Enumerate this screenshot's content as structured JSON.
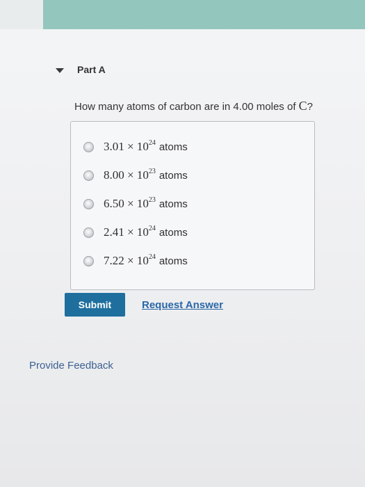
{
  "part": {
    "title": "Part A"
  },
  "question": {
    "text": "How many atoms of carbon are in 4.00 moles of ",
    "symbol": "C",
    "tail": "?"
  },
  "options": [
    {
      "mantissa": "3.01 × 10",
      "exponent": "24",
      "unit": "atoms"
    },
    {
      "mantissa": "8.00 × 10",
      "exponent": "23",
      "unit": "atoms"
    },
    {
      "mantissa": "6.50 × 10",
      "exponent": "23",
      "unit": "atoms"
    },
    {
      "mantissa": "2.41 × 10",
      "exponent": "24",
      "unit": "atoms"
    },
    {
      "mantissa": "7.22 × 10",
      "exponent": "24",
      "unit": "atoms"
    }
  ],
  "actions": {
    "submit": "Submit",
    "request_answer": "Request Answer"
  },
  "footer": {
    "feedback": "Provide Feedback"
  },
  "colors": {
    "header_band": "#93c7bd",
    "submit_bg": "#1e6f9e",
    "link": "#2a67a8"
  }
}
